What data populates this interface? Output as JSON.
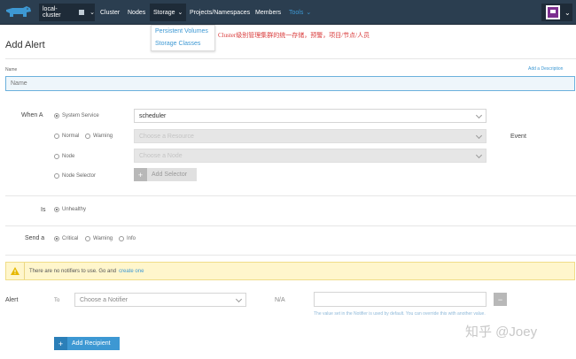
{
  "topnav": {
    "cluster_name": "local-cluster",
    "items": [
      "Cluster",
      "Nodes",
      "Storage",
      "Projects/Namespaces",
      "Members",
      "Tools"
    ]
  },
  "storage_menu": [
    "Persistent Volumes",
    "Storage Classes"
  ],
  "annotation": "Cluster级别管理集群的统一存储，预警，项目/节点/人员",
  "page": {
    "title": "Add Alert"
  },
  "form": {
    "name_label": "Name",
    "add_description": "Add a Description",
    "name_placeholder": "Name",
    "when_label": "When A",
    "when_options": [
      "System Service",
      "Normal",
      "Warning",
      "Node",
      "Node Selector"
    ],
    "service_value": "scheduler",
    "resource_placeholder": "Choose a Resource",
    "node_placeholder": "Choose a Node",
    "add_selector": "Add Selector",
    "event_label": "Event",
    "is_label": "Is",
    "is_value": "Unhealthy",
    "send_label": "Send a",
    "send_options": [
      "Critical",
      "Warning",
      "Info"
    ]
  },
  "banner": {
    "text": "There are no notifiers to use. Go and",
    "link": "create one"
  },
  "recipient": {
    "alert_label": "Alert",
    "to_label": "To",
    "notifier_placeholder": "Choose a Notifier",
    "na": "N/A",
    "hint": "The value set in the Notifier is used by default. You can override this with another value.",
    "add_recipient": "Add Recipient"
  },
  "watermark": "知乎 @Joey",
  "colors": {
    "nav_bg": "#2b3e50",
    "accent": "#3d98d3",
    "warning_bg": "#fff6cc",
    "annotation": "#d93a3a"
  }
}
